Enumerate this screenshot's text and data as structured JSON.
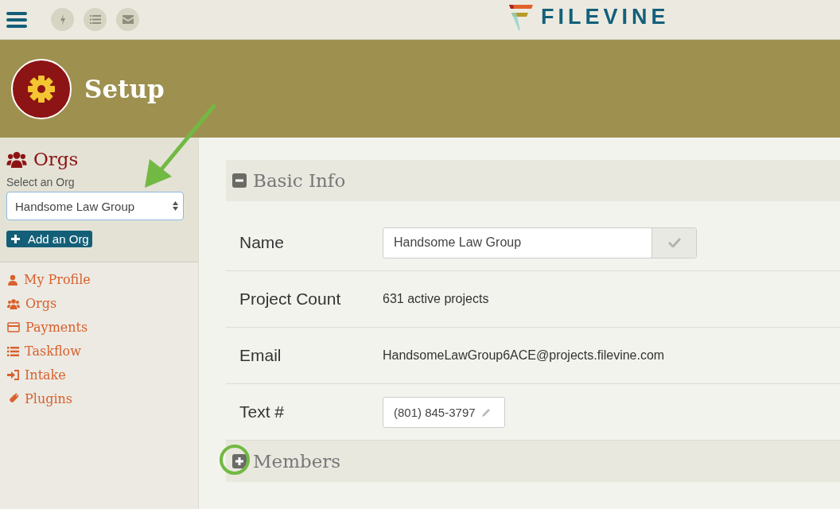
{
  "topbar": {
    "logo": "FILEVINE"
  },
  "header": {
    "title": "Setup"
  },
  "sidebar": {
    "title": "Orgs",
    "select_label": "Select an Org",
    "select_value": "Handsome Law Group",
    "add_button": "Add an Org",
    "items": [
      {
        "kind": "user",
        "label": "My Profile"
      },
      {
        "kind": "users",
        "label": "Orgs"
      },
      {
        "kind": "card",
        "label": "Payments"
      },
      {
        "kind": "list",
        "label": "Taskflow"
      },
      {
        "kind": "signin",
        "label": "Intake"
      },
      {
        "kind": "plug",
        "label": "Plugins"
      }
    ]
  },
  "sections": [
    {
      "title": "Basic Info",
      "expanded": true,
      "highlighted": false,
      "rows": [
        {
          "label": "Name",
          "kind": "input",
          "value": "Handsome Law Group"
        },
        {
          "label": "Project Count",
          "kind": "text",
          "value": "631 active projects"
        },
        {
          "label": "Email",
          "kind": "text",
          "value": "HandsomeLawGroup6ACE@projects.filevine.com"
        },
        {
          "label": "Text #",
          "kind": "phone",
          "value": "(801) 845-3797"
        }
      ]
    },
    {
      "title": "Members",
      "expanded": false,
      "highlighted": true
    }
  ]
}
